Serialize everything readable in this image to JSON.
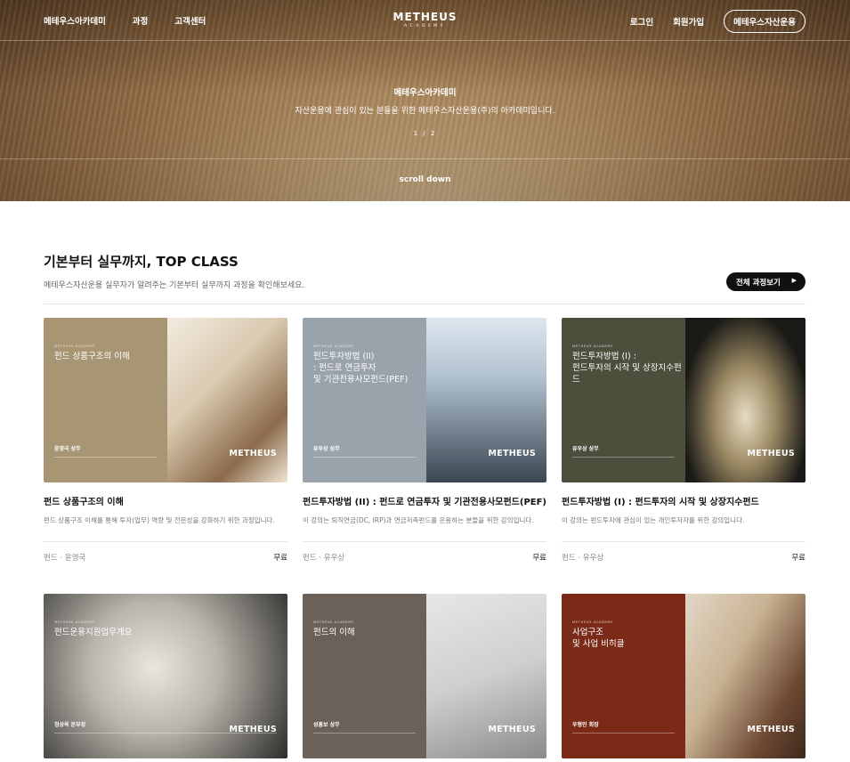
{
  "header": {
    "nav_left": [
      "메테우스아카데미",
      "과정",
      "고객센터"
    ],
    "logo_main": "METHEUS",
    "logo_sub": "ACADEMY",
    "login": "로그인",
    "signup": "회원가입",
    "asset_button": "메테우스자산운용"
  },
  "hero": {
    "title": "메테우스아카데미",
    "subtitle": "자산운용에 관심이 있는 분들을 위한 메테우스자산운용(주)의 아카데미입니다.",
    "pager": "1 / 2",
    "scroll_label": "scroll down"
  },
  "section": {
    "title": "기본부터 실무까지, TOP CLASS",
    "subtitle": "메테우스자산운용 실무자가 알려주는 기본부터 실무까지 과정을 확인해보세요.",
    "all_button": "전체 과정보기"
  },
  "cards": [
    {
      "thumb_academy": "METHEUS ACADEMY",
      "thumb_title": "펀드 상품구조의 이해",
      "thumb_author": "윤영국 상무",
      "thumb_brand": "METHEUS",
      "left_color": "#a89573",
      "title": "펀드 상품구조의 이해",
      "desc": "펀드 상품구조 이해를 통해 투자(업무) 역량 및 전문성을 강화하기 위한 과정입니다.",
      "category": "펀드",
      "instructor": "윤영국",
      "price": "무료"
    },
    {
      "thumb_academy": "METHEUS ACADEMY",
      "thumb_title": "펀드투자방법 (II)\n: 펀드로 연금투자\n 및 기관전용사모펀드(PEF)",
      "thumb_author": "유우상 상무",
      "thumb_brand": "METHEUS",
      "left_color": "#9aa3ab",
      "title": "펀드투자방법 (II) : 펀드로 연금투자 및 기관전용사모펀드(PEF)",
      "desc": "이 강의는 퇴직연금(DC, IRP)과 연금저축펀드를 운용하는 분들을 위한 강의입니다.",
      "category": "펀드",
      "instructor": "유우상",
      "price": "무료"
    },
    {
      "thumb_academy": "METHEUS ACADEMY",
      "thumb_title": "펀드투자방법 (I) :\n펀드투자의 시작 및 상장지수펀드",
      "thumb_author": "유우상 상무",
      "thumb_brand": "METHEUS",
      "left_color": "#4b4f3c",
      "title": "펀드투자방법 (I) : 펀드투자의 시작 및 상장지수펀드",
      "desc": "이 강의는 펀드투자에 관심이 있는 개인투자자를 위한 강의입니다.",
      "category": "펀드",
      "instructor": "유우상",
      "price": "무료"
    },
    {
      "thumb_academy": "METHEUS ACADEMY",
      "thumb_title": "펀드운용지원업무개요",
      "thumb_author": "정상옥 본부장",
      "thumb_brand": "METHEUS",
      "left_color": "#7b786f"
    },
    {
      "thumb_academy": "METHEUS ACADEMY",
      "thumb_title": "펀드의 이해",
      "thumb_author": "성흥보 상무",
      "thumb_brand": "METHEUS",
      "left_color": "#6b6159"
    },
    {
      "thumb_academy": "METHEUS ACADEMY",
      "thumb_title": "사업구조\n및 사업 비히클",
      "thumb_author": "우형민 회장",
      "thumb_brand": "METHEUS",
      "left_color": "#7a2a17"
    }
  ]
}
